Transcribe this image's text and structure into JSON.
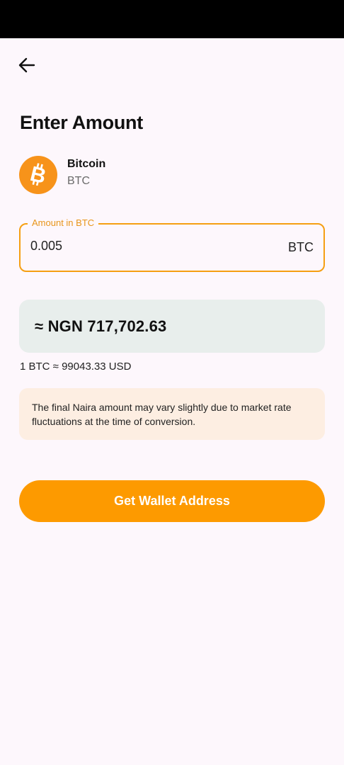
{
  "header": {
    "back_icon": "arrow-left-icon",
    "title": "Enter Amount"
  },
  "coin": {
    "icon": "bitcoin-icon",
    "icon_color": "#f7931a",
    "name": "Bitcoin",
    "symbol": "BTC"
  },
  "amount_field": {
    "label": "Amount in BTC",
    "value": "0.005",
    "unit": "BTC",
    "accent_color": "#f59f12"
  },
  "conversion": {
    "value": "≈ NGN 717,702.63",
    "rate": "1 BTC ≈ 99043.33 USD"
  },
  "notice": {
    "text": "The final Naira amount may vary slightly due to market rate fluctuations at the time of conversion."
  },
  "actions": {
    "primary_label": "Get Wallet Address",
    "primary_color": "#fd9a00"
  }
}
